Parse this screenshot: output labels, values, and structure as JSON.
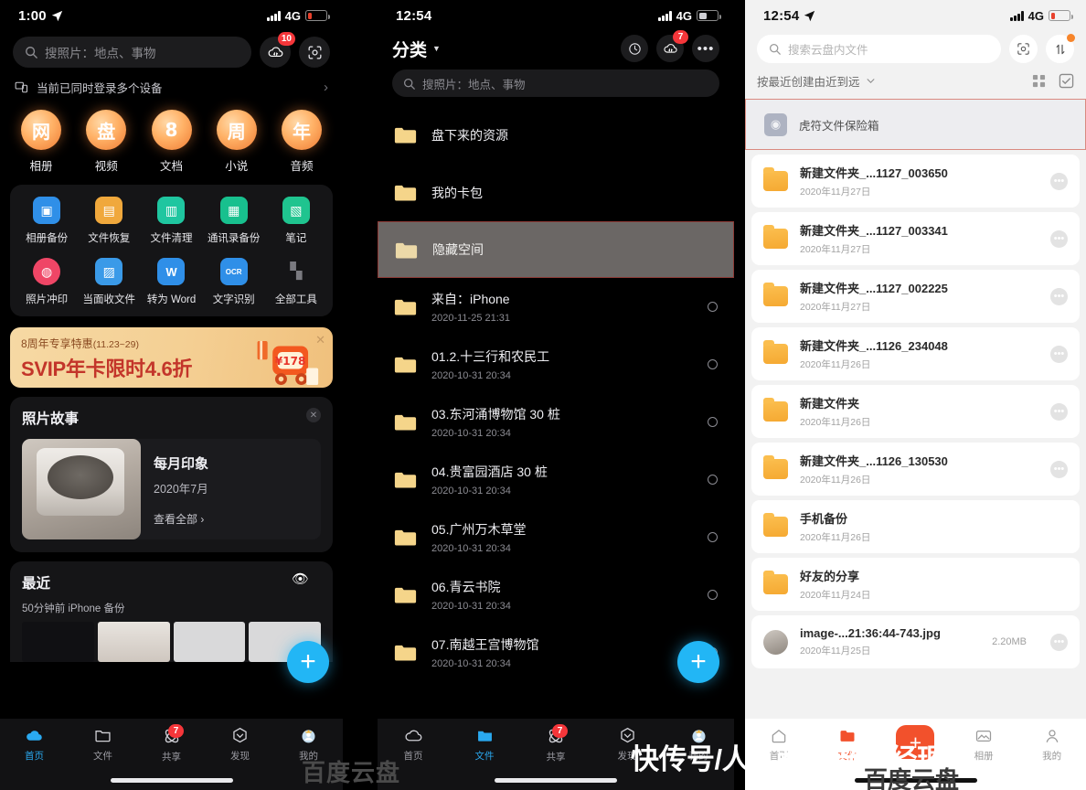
{
  "panel_home": {
    "status": {
      "time": "1:00",
      "network": "4G",
      "location_icon": "location-arrow-icon"
    },
    "search": {
      "placeholder": "搜照片：地点、事物",
      "icon": "search-icon"
    },
    "cloud_button": {
      "icon": "cloud-transfer-icon",
      "badge": "10"
    },
    "scan_button": {
      "icon": "scan-icon"
    },
    "device_notice": {
      "icon": "devices-icon",
      "text": "当前已同时登录多个设备",
      "chevron": "chevron-right-icon"
    },
    "festival_items": [
      {
        "glyph": "网",
        "label": "相册"
      },
      {
        "glyph": "盘",
        "label": "视频"
      },
      {
        "glyph": "8",
        "label": "文档"
      },
      {
        "glyph": "周",
        "label": "小说"
      },
      {
        "glyph": "年",
        "label": "音频"
      }
    ],
    "tools": [
      {
        "label": "相册备份",
        "icon": "image-backup-icon",
        "color": "#2f8fe8"
      },
      {
        "label": "文件恢复",
        "icon": "file-restore-icon",
        "color": "#f0a83c"
      },
      {
        "label": "文件清理",
        "icon": "trash-clean-icon",
        "color": "#1fc6a0"
      },
      {
        "label": "通讯录备份",
        "icon": "contacts-backup-icon",
        "color": "#18c08e"
      },
      {
        "label": "笔记",
        "icon": "note-icon",
        "color": "#1fc48f"
      },
      {
        "label": "照片冲印",
        "icon": "photo-print-icon",
        "color": "#ef4666"
      },
      {
        "label": "当面收文件",
        "icon": "face-to-face-icon",
        "color": "#3a9ae8"
      },
      {
        "label": "转为 Word",
        "icon": "word-convert-icon",
        "color": "#2f8fe8"
      },
      {
        "label": "文字识别",
        "icon": "ocr-icon",
        "color": "#2f8fe8"
      },
      {
        "label": "全部工具",
        "icon": "all-tools-icon",
        "color": "#6b6b72"
      }
    ],
    "banner": {
      "line1": "8周年专享特惠",
      "line1_sub": "(11.23~29)",
      "line2": "SVIP年卡限时4.6折",
      "close_icon": "close-icon"
    },
    "photo_story": {
      "title": "照片故事",
      "close_icon": "close-icon",
      "item_title": "每月印象",
      "item_date": "2020年7月",
      "view_all": "查看全部 ›"
    },
    "recent": {
      "title": "最近",
      "subtitle": "50分钟前 iPhone 备份",
      "eye_icon": "eye-icon"
    },
    "fab": {
      "icon": "plus-icon"
    },
    "tabs": [
      {
        "label": "首页",
        "icon": "cloud-icon",
        "active": true
      },
      {
        "label": "文件",
        "icon": "folder-icon",
        "active": false
      },
      {
        "label": "共享",
        "icon": "share-atom-icon",
        "active": false,
        "badge": "7"
      },
      {
        "label": "发现",
        "icon": "compass-icon",
        "active": false
      },
      {
        "label": "我的",
        "icon": "avatar-icon",
        "active": false
      }
    ]
  },
  "panel_files": {
    "status": {
      "time": "12:54",
      "network": "4G"
    },
    "header": {
      "title": "分类",
      "caret_icon": "caret-down-icon",
      "history_icon": "history-icon",
      "transfer_icon": "cloud-transfer-icon",
      "transfer_badge": "7",
      "more_icon": "more-dots-icon"
    },
    "search": {
      "placeholder": "搜照片：地点、事物",
      "icon": "search-icon"
    },
    "rows": [
      {
        "name": "盘下来的资源",
        "date": "",
        "radio": false,
        "highlight": false
      },
      {
        "name": "我的卡包",
        "date": "",
        "radio": false,
        "highlight": false
      },
      {
        "name": "隐藏空间",
        "date": "",
        "radio": false,
        "highlight": true
      },
      {
        "name": "来自：iPhone",
        "date": "2020-11-25 21:31",
        "radio": true,
        "highlight": false
      },
      {
        "name": "01.2.十三行和农民工",
        "date": "2020-10-31 20:34",
        "radio": true,
        "highlight": false
      },
      {
        "name": "03.东河涌博物馆 30 桩",
        "date": "2020-10-31 20:34",
        "radio": true,
        "highlight": false
      },
      {
        "name": "04.贵富园酒店 30 桩",
        "date": "2020-10-31 20:34",
        "radio": true,
        "highlight": false
      },
      {
        "name": "05.广州万木草堂",
        "date": "2020-10-31 20:34",
        "radio": true,
        "highlight": false
      },
      {
        "name": "06.青云书院",
        "date": "2020-10-31 20:34",
        "radio": true,
        "highlight": false
      },
      {
        "name": "07.南越王宫博物馆",
        "date": "2020-10-31 20:34",
        "radio": true,
        "highlight": false
      }
    ],
    "fab": {
      "icon": "plus-icon"
    },
    "tabs": [
      {
        "label": "首页",
        "icon": "cloud-icon",
        "active": false
      },
      {
        "label": "文件",
        "icon": "folder-icon",
        "active": true
      },
      {
        "label": "共享",
        "icon": "share-atom-icon",
        "active": false,
        "badge": "7"
      },
      {
        "label": "发现",
        "icon": "compass-icon",
        "active": false
      },
      {
        "label": "我的",
        "icon": "avatar-icon",
        "active": false
      }
    ]
  },
  "panel_cloud": {
    "status": {
      "time": "12:54",
      "network": "4G",
      "location_icon": "location-arrow-icon"
    },
    "search": {
      "placeholder": "搜索云盘内文件",
      "icon": "search-icon"
    },
    "scan_button": {
      "icon": "scan-icon"
    },
    "transfer_button": {
      "icon": "transfer-arrows-icon",
      "dot": true
    },
    "sort": {
      "label": "按最近创建由近到远",
      "caret_icon": "chevron-down-icon",
      "grid_icon": "grid-view-icon",
      "select_icon": "checkbox-select-icon"
    },
    "safe_row": {
      "name": "虎符文件保险箱",
      "icon": "safe-box-icon"
    },
    "rows": [
      {
        "name": "新建文件夹_...1127_003650",
        "date": "2020年11月27日",
        "size": "",
        "type": "folder"
      },
      {
        "name": "新建文件夹_...1127_003341",
        "date": "2020年11月27日",
        "size": "",
        "type": "folder"
      },
      {
        "name": "新建文件夹_...1127_002225",
        "date": "2020年11月27日",
        "size": "",
        "type": "folder"
      },
      {
        "name": "新建文件夹_...1126_234048",
        "date": "2020年11月26日",
        "size": "",
        "type": "folder"
      },
      {
        "name": "新建文件夹",
        "date": "2020年11月26日",
        "size": "",
        "type": "folder"
      },
      {
        "name": "新建文件夹_...1126_130530",
        "date": "2020年11月26日",
        "size": "",
        "type": "folder"
      },
      {
        "name": "手机备份",
        "date": "2020年11月26日",
        "size": "",
        "type": "phone-backup"
      },
      {
        "name": "好友的分享",
        "date": "2020年11月24日",
        "size": "",
        "type": "shared"
      },
      {
        "name": "image-...21:36:44-743.jpg",
        "date": "2020年11月25日",
        "size": "2.20MB",
        "type": "image"
      }
    ],
    "fab": {
      "icon": "plus-icon"
    },
    "tabs": [
      {
        "label": "首页",
        "icon": "home-icon",
        "active": false
      },
      {
        "label": "文件",
        "icon": "folder-icon",
        "active": true
      },
      {
        "label": "",
        "icon": "plus-icon",
        "active": false
      },
      {
        "label": "相册",
        "icon": "photos-icon",
        "active": false
      },
      {
        "label": "我的",
        "icon": "person-icon",
        "active": false
      }
    ]
  },
  "watermarks": {
    "baidu": "百度云盘",
    "kuaichuan": "快传号/人人都是产品经理",
    "baidu2": "百度云盘"
  },
  "colors": {
    "accent_blue": "#22b6f5",
    "accent_orange": "#f2512c",
    "badge_red": "#f5363a",
    "highlight_border": "#8d3a36",
    "folder_yellow": "#f5c35a"
  }
}
